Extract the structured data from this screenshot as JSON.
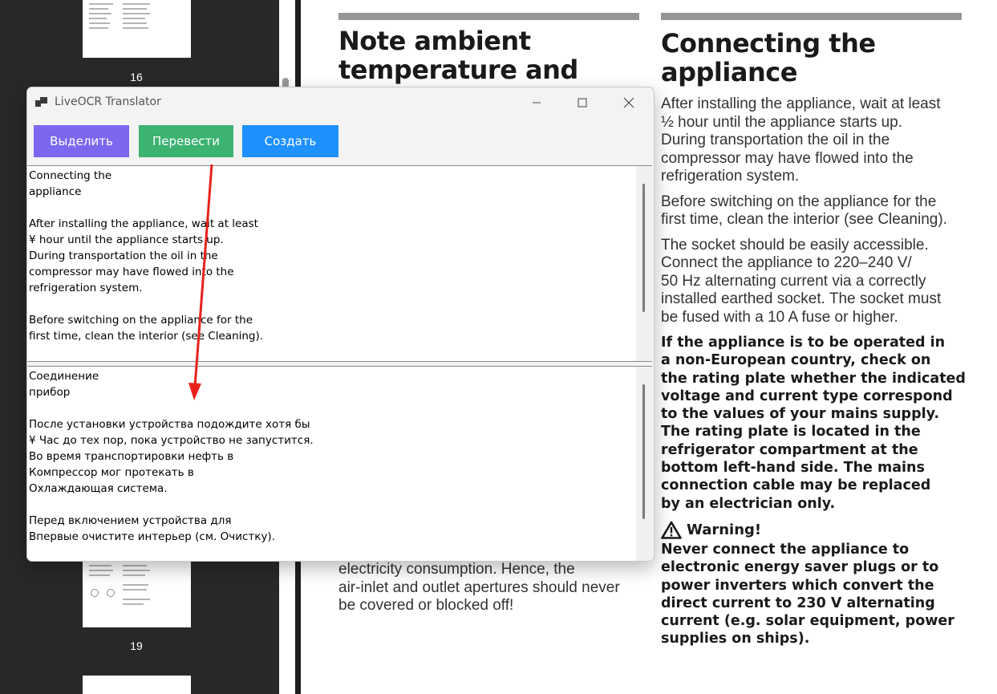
{
  "thumbnails": {
    "page_labels": [
      "16",
      "19"
    ]
  },
  "document": {
    "left_column": {
      "heading": "Note ambient\ntemperature and",
      "tail_text": "electricity consumption. Hence, the\nair-inlet and outlet apertures should never\nbe covered or blocked off!"
    },
    "right_column": {
      "heading": "Connecting the\nappliance",
      "paragraphs": [
        "After installing the appliance, wait at least\n½ hour until the appliance starts up.\nDuring transportation the oil in the\ncompressor may have flowed into the\nrefrigeration system.",
        "Before switching on the appliance for the\nfirst time, clean the interior (see Cleaning).",
        "The socket should be easily accessible.\nConnect the appliance to 220–240 V/\n50 Hz alternating current via a correctly\ninstalled earthed socket. The socket must\nbe fused with a 10 A fuse or higher."
      ],
      "bold_paragraph": "If the appliance is to be operated in\na non-European country, check on\nthe rating plate whether the indicated\nvoltage and current type correspond\nto the values of your mains supply.\nThe rating plate is located in the\nrefrigerator compartment at the\nbottom left-hand side. The mains\nconnection cable may be replaced\nby an electrician only.",
      "warning_title": "Warning!",
      "warning_text": "Never connect the appliance to\nelectronic energy saver plugs or to\npower inverters which convert the\ndirect current to 230 V alternating\ncurrent (e.g. solar equipment, power\nsupplies on ships)."
    }
  },
  "translator": {
    "title": "LiveOCR Translator",
    "buttons": {
      "select": "Выделить",
      "translate": "Перевести",
      "create": "Создать"
    },
    "button_colors": {
      "select": "#7b68ee",
      "translate": "#3cb371",
      "create": "#1e90ff"
    },
    "source_text": "Connecting the\nappliance\n\nAfter installing the appliance, wait at least\n¥ hour until the appliance starts up.\nDuring transportation the oil in the\ncompressor may have flowed into the\nrefrigeration system.\n\nBefore switching on the appliance for the\nfirst time, clean the interior (see Cleaning).",
    "translated_text": "Соединение\nприбор\n\nПосле установки устройства подождите хотя бы\n¥ Час до тех пор, пока устройство не запустится.\nВо время транспортировки нефть в\nКомпрессор мог протекать в\nОхлаждающая система.\n\nПеред включением устройства для\nВпервые очистите интерьер (см. Очистку)."
  },
  "annotation": {
    "arrow_color": "#e8221b"
  }
}
